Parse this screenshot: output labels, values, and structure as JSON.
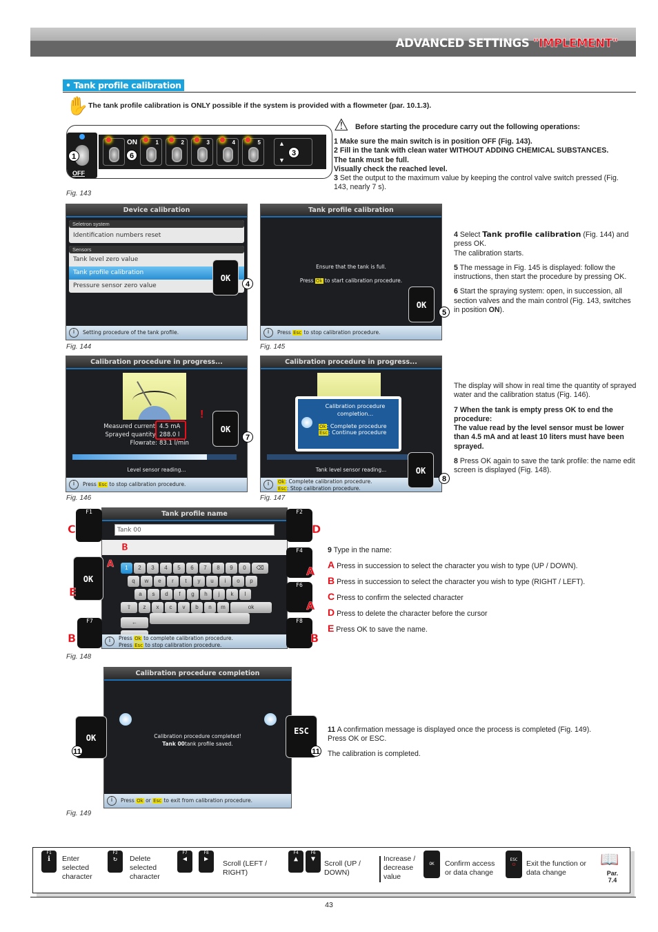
{
  "header": {
    "title_prefix": "ADVANCED SETTINGS ",
    "title_highlight": "\"IMPLEMENT\""
  },
  "section": {
    "title": "• Tank profile calibration"
  },
  "note": {
    "icon": "hand-stop-icon",
    "text": "The tank profile calibration is ONLY possible if the system is provided with a flowmeter (par. 10.1.3)."
  },
  "fig143": {
    "caption": "Fig. 143",
    "main_switch": {
      "label": "OFF",
      "callout": "1"
    },
    "on_label": "ON",
    "main_control_callout": "6",
    "sections": [
      "1",
      "2",
      "3",
      "4",
      "5"
    ],
    "valve_callout": "3"
  },
  "warning": {
    "icon": "warning-triangle-icon",
    "intro": "Before starting the procedure carry out the following operations:",
    "steps": [
      {
        "num": "1",
        "text": "Make sure the main switch is in position OFF (Fig. 143).",
        "bold": true
      },
      {
        "num": "2",
        "text": "Fill in the tank with clean water WITHOUT ADDING CHEMICAL SUBSTANCES.",
        "bold": true
      },
      {
        "num": "",
        "text": "The tank must be full.",
        "bold": true
      },
      {
        "num": "",
        "text": "Visually check the reached level.",
        "bold": true
      },
      {
        "num": "3",
        "text": "Set the output to the maximum value by keeping the control valve switch pressed (Fig. 143, nearly 7 s).",
        "bold": false
      }
    ]
  },
  "fig144": {
    "caption": "Fig. 144",
    "title": "Device calibration",
    "group1": "Seletron system",
    "group1_items": [
      "Identification numbers reset"
    ],
    "group2": "Sensors",
    "group2_items": [
      "Tank level zero value",
      "Tank profile calibration",
      "Pressure sensor zero value"
    ],
    "selected_index": 1,
    "footer": "Setting procedure of the tank profile.",
    "key": "OK",
    "callout": "4"
  },
  "fig145": {
    "caption": "Fig. 145",
    "title": "Tank profile calibration",
    "line1": "Ensure that the tank is full.",
    "line2_pre": "Press ",
    "line2_key": "Ok",
    "line2_post": " to start calibration procedure.",
    "footer_pre": "Press ",
    "footer_key": "Esc",
    "footer_post": " to stop calibration procedure.",
    "key": "OK",
    "callout": "5"
  },
  "steps_4_6": [
    {
      "num": "4",
      "pre": "Select ",
      "strong": "Tank profile calibration",
      "post": " (Fig. 144) and press OK.",
      "extra": "The calibration starts."
    },
    {
      "num": "5",
      "pre": "The message in Fig. 145 is displayed: follow the instructions, then start the procedure by pressing OK.",
      "strong": "",
      "post": "",
      "extra": ""
    },
    {
      "num": "6",
      "pre": "Start the spraying system: open, in succession, all section valves and the main control (Fig. 143, switches in position ",
      "strong": "ON",
      "post": ").",
      "extra": ""
    }
  ],
  "fig146": {
    "caption": "Fig. 146",
    "title": "Calibration procedure in progress...",
    "rows": [
      {
        "label": "Measured current:",
        "value": "4.5 mA"
      },
      {
        "label": "Sprayed quantity:",
        "value": "288.0 l"
      },
      {
        "label": "Flowrate:",
        "value": "83.1 l/min"
      }
    ],
    "progress": 0.82,
    "status": "Level sensor reading...",
    "footer_pre": "Press ",
    "footer_key": "Esc",
    "footer_post": " to stop calibration procedure.",
    "key": "OK",
    "callout": "7",
    "alert": "!"
  },
  "fig147": {
    "caption": "Fig. 147",
    "title": "Calibration procedure in progress...",
    "dialog_title": "Calibration procedure completion...",
    "dialog_ok_key": "Ok",
    "dialog_ok": ": Complete procedure",
    "dialog_esc_key": "Esc",
    "dialog_esc": ": Continue procedure",
    "status": "Tank level sensor reading...",
    "footer1_key": "Ok",
    "footer1": ": Complete calibration procedure.",
    "footer2_key": "Esc",
    "footer2": ": Stop calibration procedure.",
    "key": "OK",
    "callout": "8"
  },
  "steps_7_8": {
    "intro": "The display will show in real time the quantity of sprayed water and the calibration status (Fig. 146).",
    "step7_num": "7",
    "step7": "When the tank is empty press OK to end the procedure:",
    "step7_rule": "The value read by the level sensor must be lower than 4.5 mA and at least 10 liters must have been sprayed.",
    "step8_num": "8",
    "step8": "Press OK again to save the tank profile: the name edit screen is displayed (Fig. 148)."
  },
  "fig148": {
    "caption": "Fig. 148",
    "title": "Tank profile name",
    "input_value": "Tank 00",
    "rows": [
      [
        "1",
        "2",
        "3",
        "4",
        "5",
        "6",
        "7",
        "8",
        "9",
        "0",
        "⌫"
      ],
      [
        "q",
        "w",
        "e",
        "r",
        "t",
        "y",
        "u",
        "i",
        "o",
        "p"
      ],
      [
        "a",
        "s",
        "d",
        "f",
        "g",
        "h",
        "j",
        "k",
        "l"
      ],
      [
        "⇧",
        "z",
        "x",
        "c",
        "v",
        "b",
        "n",
        "m",
        "ok"
      ],
      [
        "←",
        " ",
        "→"
      ]
    ],
    "footer1_pre": "Press ",
    "footer1_key": "Ok",
    "footer1_post": " to complete calibration procedure.",
    "footer2_pre": "Press ",
    "footer2_key": "Esc",
    "footer2_post": " to stop calibration procedure.",
    "keys": {
      "f1": "F1",
      "f2": "F2",
      "f4": "F4",
      "f6": "F6",
      "f7": "F7",
      "f8": "F8",
      "ok": "OK"
    },
    "callouts": {
      "f1": "C",
      "f2": "D",
      "f4": "A",
      "f6": "A",
      "f7": "B",
      "f8": "B",
      "ok": "E",
      "vertical": "A",
      "horizontal": "B"
    }
  },
  "step9": {
    "intro_num": "9",
    "intro": "Type in the name:",
    "items": [
      {
        "letter": "A",
        "text": "Press in succession to select the character you wish to type (UP / DOWN)."
      },
      {
        "letter": "B",
        "text": "Press in succession to select the character you wish to type (RIGHT / LEFT)."
      },
      {
        "letter": "C",
        "text": "Press to confirm the selected character"
      },
      {
        "letter": "D",
        "text": "Press to delete the character before the cursor"
      },
      {
        "letter": "E",
        "text": "Press OK to save the name."
      }
    ]
  },
  "fig149": {
    "caption": "Fig. 149",
    "title": "Calibration procedure completion",
    "line1": "Calibration procedure completed!",
    "line2_strong": "Tank 00",
    "line2": "tank profile saved.",
    "footer_pre": "Press ",
    "footer_key1": "Ok",
    "footer_mid": " or ",
    "footer_key2": "Esc",
    "footer_post": " to exit from calibration procedure.",
    "key_ok": "OK",
    "key_esc": "ESC",
    "callout": "11"
  },
  "step11": {
    "num": "11",
    "text": "A confirmation message is displayed once the process is completed (Fig. 149).",
    "press": "Press OK or ESC.",
    "done": "The calibration is completed."
  },
  "legend": {
    "items": [
      {
        "keys": [
          "F1"
        ],
        "text": "Enter selected character"
      },
      {
        "keys": [
          "F2"
        ],
        "text": "Delete selected character"
      },
      {
        "keys": [
          "F7",
          "F8"
        ],
        "text": "Scroll (LEFT / RIGHT)"
      },
      {
        "keys": [
          "F4",
          "F6"
        ],
        "text": "Scroll (UP / DOWN)"
      },
      {
        "keys": [],
        "text": "Increase / decrease value"
      },
      {
        "keys": [
          "OK"
        ],
        "text": "Confirm access or data change"
      },
      {
        "keys": [
          "ESC"
        ],
        "text": "Exit the function or data change"
      }
    ],
    "ref": "Par. 7.4"
  },
  "page_number": "43"
}
